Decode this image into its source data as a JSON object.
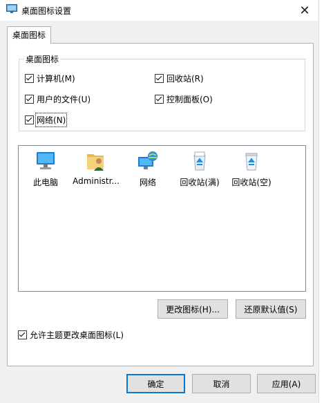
{
  "window": {
    "title": "桌面图标设置",
    "close_glyph": "✕"
  },
  "tabs": [
    {
      "label": "桌面图标"
    }
  ],
  "group": {
    "title": "桌面图标",
    "checkboxes": [
      {
        "label": "计算机(M)",
        "checked": true
      },
      {
        "label": "回收站(R)",
        "checked": true
      },
      {
        "label": "用户的文件(U)",
        "checked": true
      },
      {
        "label": "控制面板(O)",
        "checked": true
      },
      {
        "label": "网络(N)",
        "checked": true
      }
    ]
  },
  "icons": [
    {
      "label": "此电脑",
      "icon": "computer-icon"
    },
    {
      "label": "Administr...",
      "icon": "user-folder-icon"
    },
    {
      "label": "网络",
      "icon": "network-icon"
    },
    {
      "label": "回收站(满)",
      "icon": "recycle-bin-full-icon"
    },
    {
      "label": "回收站(空)",
      "icon": "recycle-bin-empty-icon"
    }
  ],
  "buttons": {
    "change_icon": "更改图标(H)...",
    "restore_default": "还原默认值(S)",
    "ok": "确定",
    "cancel": "取消",
    "apply": "应用(A)"
  },
  "allow_themes": {
    "label": "允许主题更改桌面图标(L)",
    "checked": true
  },
  "colors": {
    "accent": "#0078d7",
    "panel": "#ffffff",
    "dialog_bg": "#f0f0f0"
  }
}
